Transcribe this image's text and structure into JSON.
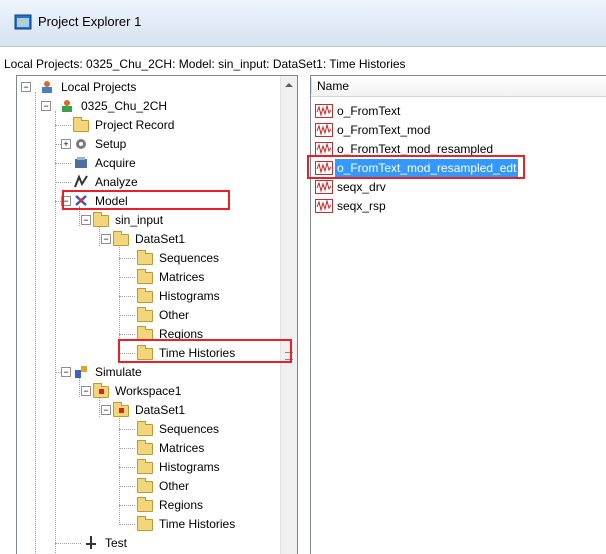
{
  "window": {
    "title": "Project Explorer 1"
  },
  "breadcrumb": "Local Projects: 0325_Chu_2CH: Model: sin_input: DataSet1: Time Histories",
  "tree": {
    "root": "Local Projects",
    "project": "0325_Chu_2CH",
    "project_record": "Project Record",
    "setup": "Setup",
    "acquire": "Acquire",
    "analyze": "Analyze",
    "model": "Model",
    "sin_input": "sin_input",
    "model_dataset": "DataSet1",
    "model_folders": [
      "Sequences",
      "Matrices",
      "Histograms",
      "Other",
      "Regions",
      "Time Histories"
    ],
    "simulate": "Simulate",
    "workspace": "Workspace1",
    "sim_dataset": "DataSet1",
    "sim_folders": [
      "Sequences",
      "Matrices",
      "Histograms",
      "Other",
      "Regions",
      "Time Histories"
    ],
    "test": "Test",
    "expander_minus": "−",
    "expander_plus": "+"
  },
  "list": {
    "column": "Name",
    "items": [
      "o_FromText",
      "o_FromText_mod",
      "o_FromText_mod_resampled",
      "o_FromText_mod_resampled_edt",
      "seqx_drv",
      "seqx_rsp"
    ],
    "selected_index": 3
  },
  "colors": {
    "highlight": "#e8202a",
    "selection": "#3399ff",
    "folder": "#f3d67b"
  }
}
